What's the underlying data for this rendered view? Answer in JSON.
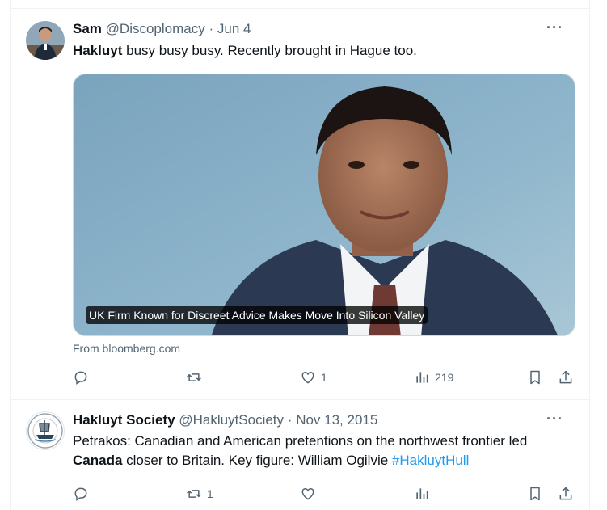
{
  "tweets": [
    {
      "name": "Sam",
      "handle": "@Discoplomacy",
      "separator": "·",
      "date": "Jun 4",
      "more": "···",
      "text_bold": "Hakluyt",
      "text_rest": " busy busy busy. Recently brought in Hague too.",
      "card": {
        "caption": "UK Firm Known for Discreet Advice Makes Move Into Silicon Valley",
        "source": "From bloomberg.com"
      },
      "actions": {
        "replies": "",
        "reposts": "",
        "likes": "1",
        "views": "219"
      }
    },
    {
      "name": "Hakluyt Society",
      "handle": "@HakluytSociety",
      "separator": "·",
      "date": "Nov 13, 2015",
      "more": "···",
      "text_line1": "Petrakos: Canadian and American pretentions on the northwest frontier led",
      "text_bold": "Canada",
      "text_rest": " closer to Britain. Key figure: William Ogilvie ",
      "hashtag": "#HakluytHull",
      "actions": {
        "replies": "",
        "reposts": "1",
        "likes": "",
        "views": ""
      }
    }
  ],
  "colors": {
    "text": "#0f1419",
    "secondary": "#536471",
    "link": "#1d9bf0",
    "border": "#eff3f4"
  }
}
